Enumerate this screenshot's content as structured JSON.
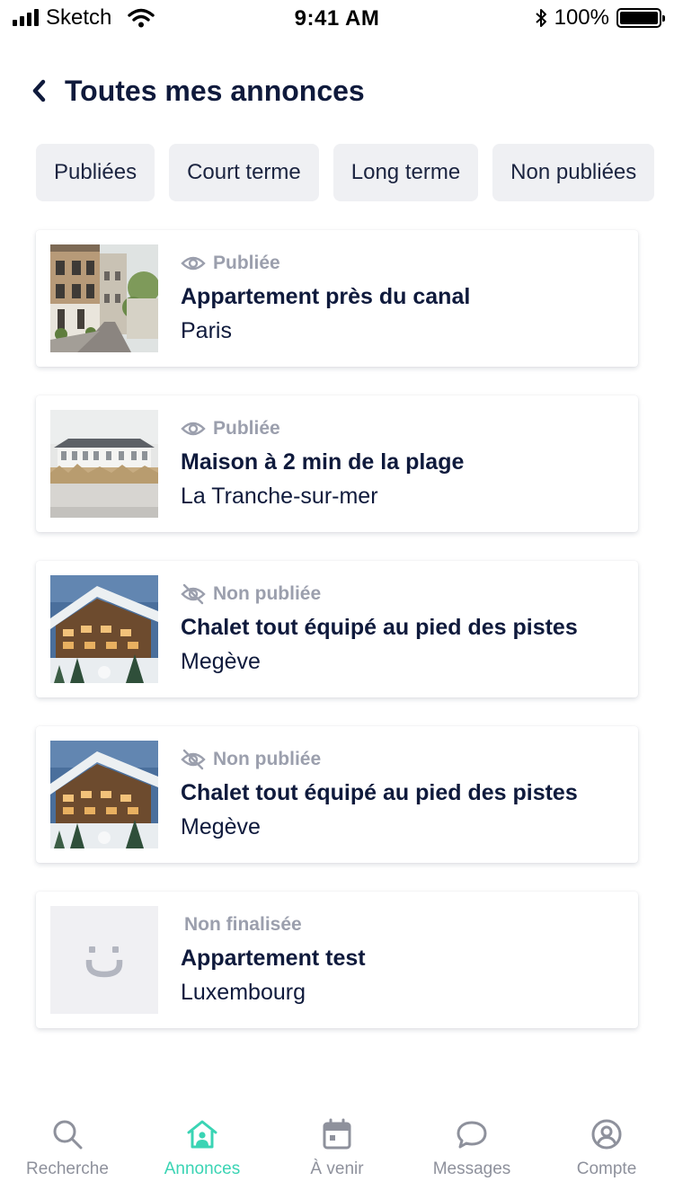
{
  "status_bar": {
    "carrier": "Sketch",
    "time": "9:41 AM",
    "battery": "100%",
    "battery_level": 1.0
  },
  "header": {
    "title": "Toutes mes annonces",
    "back_icon": "chevron-left-icon"
  },
  "filters": [
    {
      "label": "Publiées"
    },
    {
      "label": "Court terme"
    },
    {
      "label": "Long terme"
    },
    {
      "label": "Non publiées"
    }
  ],
  "listings": [
    {
      "status": "Publiée",
      "status_icon": "eye-icon",
      "title": "Appartement près du canal",
      "city": "Paris",
      "image": "street-photo"
    },
    {
      "status": "Publiée",
      "status_icon": "eye-icon",
      "title": "Maison à 2 min de la plage",
      "city": "La Tranche-sur-mer",
      "image": "beach-house-photo"
    },
    {
      "status": "Non publiée",
      "status_icon": "eye-off-icon",
      "title": "Chalet tout équipé au pied des pistes",
      "city": "Megève",
      "image": "chalet-photo"
    },
    {
      "status": "Non publiée",
      "status_icon": "eye-off-icon",
      "title": "Chalet tout équipé au pied des pistes",
      "city": "Megève",
      "image": "chalet-photo"
    },
    {
      "status": "Non finalisée",
      "status_icon": "",
      "title": "Appartement test",
      "city": "Luxembourg",
      "image": "placeholder-logo"
    }
  ],
  "tabbar": {
    "active_color": "#3ad4b4",
    "inactive_color": "#8e919c",
    "tabs": [
      {
        "label": "Recherche",
        "icon": "search-icon",
        "active": false
      },
      {
        "label": "Annonces",
        "icon": "house-user-icon",
        "active": true
      },
      {
        "label": "À venir",
        "icon": "calendar-icon",
        "active": false
      },
      {
        "label": "Messages",
        "icon": "chat-bubble-icon",
        "active": false
      },
      {
        "label": "Compte",
        "icon": "user-circle-icon",
        "active": false
      }
    ]
  }
}
